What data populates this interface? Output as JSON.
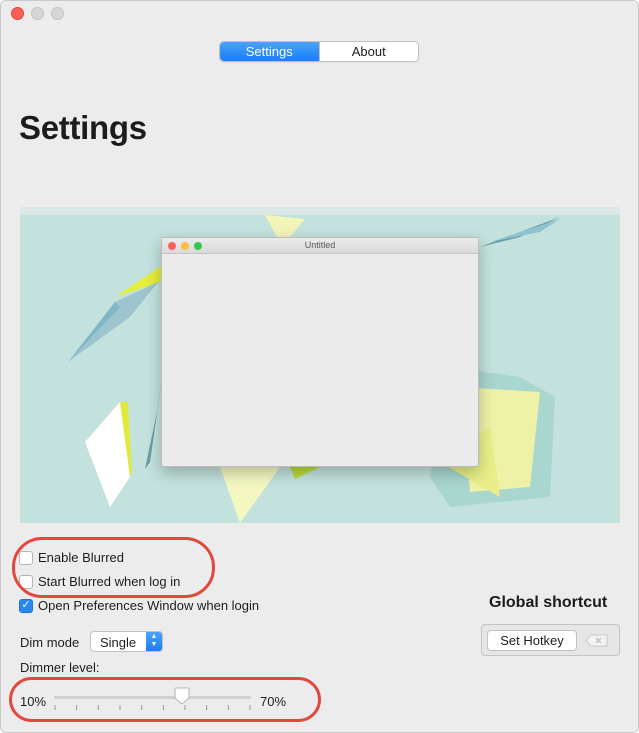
{
  "window": {
    "tabs": [
      {
        "label": "Settings",
        "active": true
      },
      {
        "label": "About",
        "active": false
      }
    ]
  },
  "page": {
    "title": "Settings"
  },
  "preview": {
    "window_title": "Untitled"
  },
  "options": {
    "enable_blurred": {
      "label": "Enable Blurred",
      "checked": false
    },
    "start_blurred": {
      "label": "Start Blurred when log in",
      "checked": false
    },
    "open_prefs": {
      "label": "Open Preferences Window when login",
      "checked": true
    }
  },
  "shortcut": {
    "title": "Global shortcut",
    "button_label": "Set Hotkey"
  },
  "dim_mode": {
    "label": "Dim mode",
    "value": "Single"
  },
  "dimmer": {
    "label": "Dimmer level:",
    "min_label": "10%",
    "max_label": "70%",
    "level_fraction": 0.65
  },
  "colors": {
    "accent": "#1a7ff2",
    "highlight": "#e2483d"
  }
}
